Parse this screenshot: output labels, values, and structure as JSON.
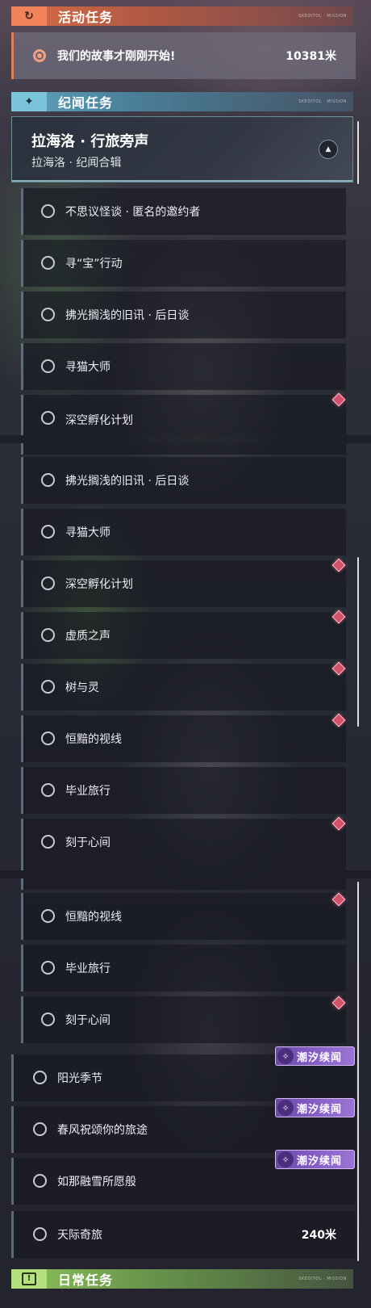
{
  "headers": {
    "event": {
      "title": "活动任务",
      "tiny": "SKEDITOL · MISSION"
    },
    "lore": {
      "title": "纪闻任务",
      "tiny": "SKEDITOL · MISSION"
    },
    "daily": {
      "title": "日常任务",
      "tiny": "SKEDITOL · MISSION",
      "icon_text": "!"
    }
  },
  "event_quest": {
    "name": "我们的故事才刚刚开始!",
    "distance": "10381米"
  },
  "lore_group": {
    "title": "拉海洛 · 行旅旁声",
    "subtitle": "拉海洛 · 纪闻合辑"
  },
  "panel1": {
    "items": [
      {
        "label": "不思议怪谈 · 匿名的邀约者"
      },
      {
        "label": "寻“宝”行动"
      },
      {
        "label": "拂光搁浅的旧讯 · 后日谈"
      },
      {
        "label": "寻猫大师"
      },
      {
        "label": "深空孵化计划"
      }
    ]
  },
  "panel2": {
    "items": [
      {
        "label": "拂光搁浅的旧讯 · 后日谈"
      },
      {
        "label": "寻猫大师"
      },
      {
        "label": "深空孵化计划"
      },
      {
        "label": "虚质之声"
      },
      {
        "label": "树与灵"
      },
      {
        "label": "恒黯的视线"
      },
      {
        "label": "毕业旅行"
      },
      {
        "label": "刻于心间"
      }
    ]
  },
  "panel3": {
    "items": [
      {
        "label": "恒黯的视线"
      },
      {
        "label": "毕业旅行"
      },
      {
        "label": "刻于心间"
      },
      {
        "label": "阳光季节",
        "badge": "潮汐续闻"
      },
      {
        "label": "春风祝颂你的旅途",
        "badge": "潮汐续闻"
      },
      {
        "label": "如那融雪所愿般",
        "badge": "潮汐续闻"
      },
      {
        "label": "天际奇旅",
        "distance": "240米"
      }
    ]
  },
  "icons": [
    "quest-return-icon",
    "star-compass-icon",
    "navigate-arrow-icon",
    "radio-circle-icon",
    "red-diamond-marker-icon",
    "tide-feather-icon",
    "exclamation-box-icon"
  ],
  "colors": {
    "event_accent": "#e0805a",
    "lore_accent": "#5ea4be",
    "daily_accent": "#8fc25a",
    "marker": "#d5506a",
    "badge": "#8b63c9"
  }
}
